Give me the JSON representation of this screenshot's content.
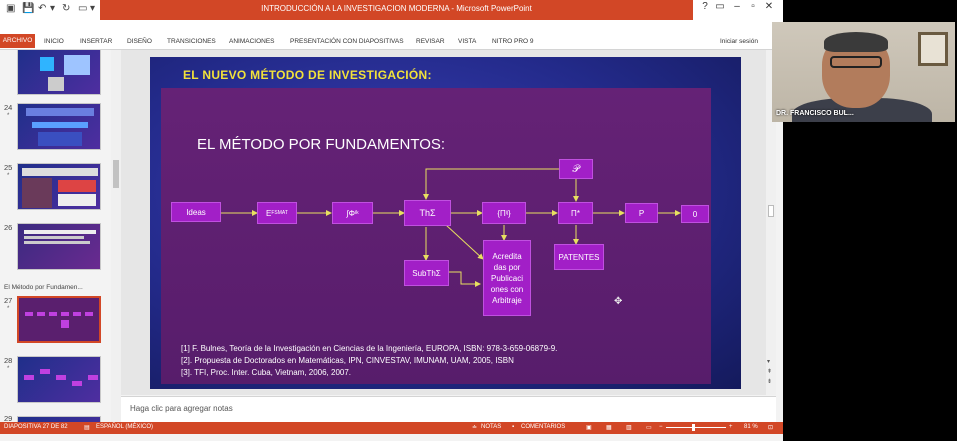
{
  "window": {
    "title": "INTRODUCCIÓN A LA INVESTIGACION MODERNA - Microsoft PowerPoint",
    "controls": {
      "help": "?",
      "minimize": "–",
      "restore": "▫",
      "close": "✕"
    },
    "ribbon_toggle": "▭"
  },
  "qat": {
    "save": "💾",
    "undo": "↶",
    "redo": "↻",
    "customize": "▾"
  },
  "ribbon": {
    "archivo": "ARCHIVO",
    "tabs": [
      "INICIO",
      "INSERTAR",
      "DISEÑO",
      "TRANSICIONES",
      "ANIMACIONES",
      "PRESENTACIÓN CON DIAPOSITIVAS",
      "REVISAR",
      "VISTA",
      "NITRO PRO 9"
    ],
    "signin": "Iniciar sesión"
  },
  "thumbnails": {
    "items": [
      {
        "num": "24",
        "star": "*"
      },
      {
        "num": "25",
        "star": "*"
      },
      {
        "num": "26",
        "star": ""
      },
      {
        "num": "27",
        "star": "*"
      },
      {
        "num": "28",
        "star": "*"
      },
      {
        "num": "29",
        "star": ""
      }
    ],
    "section": "El Método por Fundamen..."
  },
  "slide": {
    "title": "EL NUEVO MÉTODO DE INVESTIGACIÓN:",
    "heading": "EL MÉTODO POR FUNDAMENTOS:",
    "boxes": {
      "ideas": "Ideas",
      "efsmat": "E",
      "efsmat_sub": "FSMAT",
      "jphi": "∫Φ",
      "jphi_sub": "ik",
      "thsigma": "ThΣ",
      "pi_ij": "{Π",
      "pi_ij_sub": "ij",
      "pi_ij_end": "}",
      "pi_star": "Π*",
      "p": "P",
      "zero": "0",
      "script_p": "𝒫",
      "subth": "SubThΣ",
      "acredita": "Acredita das por Publicaci ones con Arbitraje",
      "patentes": "PATENTES"
    },
    "refs": [
      "[1] F. Bulnes, Teoría de la Investigación en Ciencias de la Ingeniería, EUROPA, ISBN: 978-3-659-06879-9.",
      "[2]. Propuesta de Doctorados en Matemáticas, IPN, CINVESTAV, IMUNAM, UAM, 2005, ISBN",
      "[3]. TFI, Proc. Inter. Cuba, Vietnam, 2006, 2007."
    ]
  },
  "notes": {
    "placeholder": "Haga clic para agregar notas"
  },
  "status": {
    "slide": "DIAPOSITIVA 27 DE 82",
    "lang": "ESPAÑOL (MÉXICO)",
    "notes": "NOTAS",
    "comments": "COMENTARIOS",
    "zoom_minus": "−",
    "zoom_plus": "+",
    "zoom": "81 %",
    "zoom_level": 0.45
  },
  "webcam": {
    "name": "DR. FRANCISCO BUL..."
  },
  "colors": {
    "accent": "#d24726",
    "box": "#a21fc7",
    "slide_title": "#f2e23a"
  }
}
